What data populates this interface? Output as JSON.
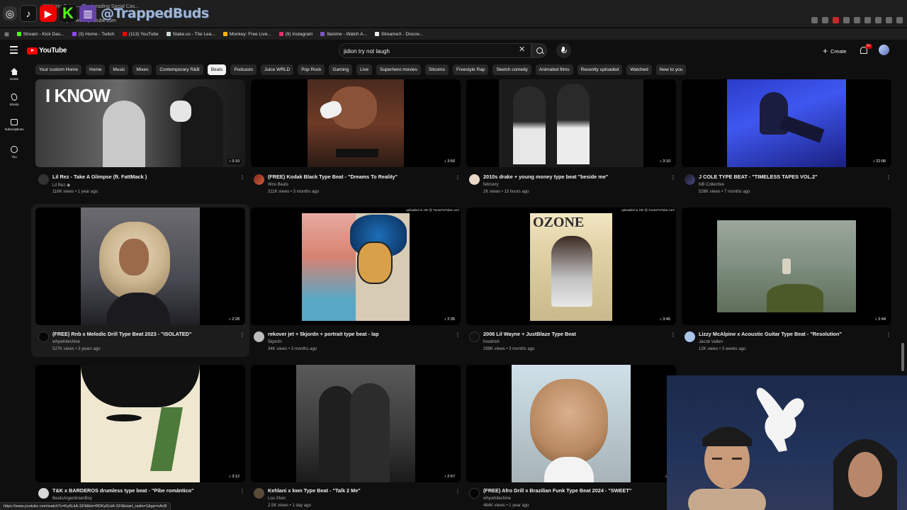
{
  "overlay": {
    "handle": "@TrappedBuds"
  },
  "browser": {
    "tab_title": "(211) YouTube — The Leading Social Cas...",
    "url": "https://www.youtube.com",
    "bookmarks": [
      {
        "label": "Stream - Kick Das...",
        "color": "#53fc18"
      },
      {
        "label": "(3) Home - Twitch",
        "color": "#9146ff"
      },
      {
        "label": "(113) YouTube",
        "color": "#ff0000"
      },
      {
        "label": "Stake.us - The Lea...",
        "color": "#cfd8dc"
      },
      {
        "label": "Monkey: Free Live...",
        "color": "#ffb300"
      },
      {
        "label": "(9) Instagram",
        "color": "#e1306c"
      },
      {
        "label": "9anime - Watch A...",
        "color": "#7e57c2"
      },
      {
        "label": "StreameX - Discov...",
        "color": "#eeeeee"
      }
    ],
    "status_url": "https://www.youtube.com/watch?v=Ky6LkA-3Z4&list=RDKy6LkA-3Z4&start_radio=1&pp=oAcB"
  },
  "masthead": {
    "logo_text": "YouTube",
    "search_value": "jidion try not laugh",
    "create_label": "Create",
    "notif_count": "9+"
  },
  "guide": [
    {
      "label": "Home",
      "icon": "home-icon"
    },
    {
      "label": "Shorts",
      "icon": "shorts-icon"
    },
    {
      "label": "Subscriptions",
      "icon": "subscriptions-icon"
    },
    {
      "label": "You",
      "icon": "you-icon"
    }
  ],
  "chips": [
    "Your custom Home",
    "Home",
    "Music",
    "Mixes",
    "Contemporary R&B",
    "Beats",
    "Podcasts",
    "Juice WRLD",
    "Pop Rock",
    "Gaming",
    "Live",
    "Superhero movies",
    "Sitcoms",
    "Freestyle Rap",
    "Sketch comedy",
    "Animated films",
    "Recently uploaded",
    "Watched",
    "New to you"
  ],
  "active_chip": "Beats",
  "videos": [
    {
      "title": "Lil Rez - Take A Glimpse (ft. FattMack )",
      "channel": "Lil Rez ◉",
      "meta": "116K views • 1 year ago",
      "duration": "♪ 3:10"
    },
    {
      "title": "(FREE) Kodak Black Type Beat - \"Dreams To Reality\"",
      "channel": "Wns Beats",
      "meta": "311K views • 3 months ago",
      "duration": "♪ 3:50"
    },
    {
      "title": "2010s drake + young money type beat \"beside me\"",
      "channel": "februxry",
      "meta": "2K views • 13 hours ago",
      "duration": "♪ 3:10"
    },
    {
      "title": "J COLE TYPE BEAT - \"TIMELESS TAPES VOL.2\"",
      "channel": "NB Collective",
      "meta": "526K views • 7 months ago",
      "duration": "♪ 22:06"
    },
    {
      "title": "(FREE) Rnb x Melodic Drill Type Beat 2023 - \"ISOLATED\"",
      "channel": "whywhiteshine",
      "meta": "527K views • 3 years ago",
      "duration": "♪ 2:28"
    },
    {
      "title": "rekover jet + 5kjordn + portrait type beat - lap",
      "channel": "5kjordn",
      "meta": "34K views • 3 months ago",
      "duration": "♪ 2:35",
      "hd": "uploaded in HD @ TunesToTube.com"
    },
    {
      "title": "2006 Lil Wayne + JustBlaze Type Beat",
      "channel": "hoodrixh",
      "meta": "299K views • 3 months ago",
      "duration": "♪ 3:45",
      "hd": "uploaded in HD @ TunesToTube.com"
    },
    {
      "title": "Lizzy McAlpine x Acoustic Guitar Type Beat - \"Resolution\"",
      "channel": "Jacob Vallen",
      "meta": "12K views • 3 weeks ago",
      "duration": "♪ 2:44"
    },
    {
      "title": "T&K x BARDEROS drumless type beat - \"Pibe romántico\"",
      "channel": "BeatsArgentinianBoy",
      "meta": "",
      "duration": "♪ 3:12"
    },
    {
      "title": "Kehlani x kwn Type Beat - \"Talk 2 Me\"",
      "channel": "Lou Xtwo",
      "meta": "2.5K views • 1 day ago",
      "duration": "♪ 2:57"
    },
    {
      "title": "(FREE) Afro Drill x Brazilian Funk Type Beat 2024 - \"SWEET\"",
      "channel": "whywhiteshine",
      "meta": "464K views • 1 year ago",
      "duration": "♪ 2"
    }
  ],
  "thumb_text": {
    "ozone": "OZONE",
    "iknow": "I KNOW"
  }
}
